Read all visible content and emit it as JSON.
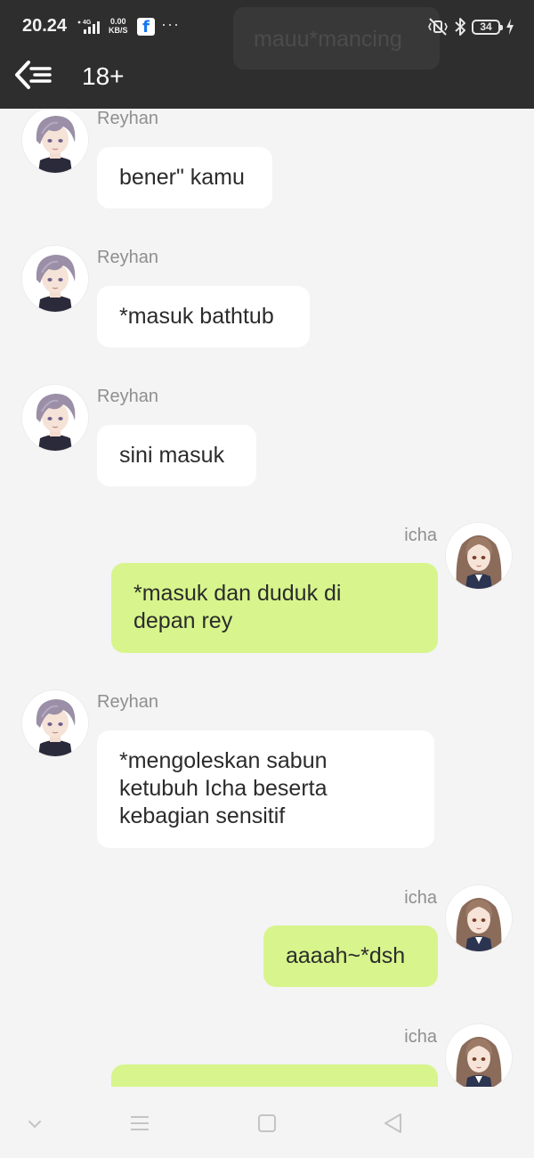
{
  "status_bar": {
    "time": "20.24",
    "network": "4G",
    "speed_value": "0.00",
    "speed_unit": "KB/S",
    "fb_letter": "f",
    "more_dots": "···",
    "battery_level": "34"
  },
  "notification_preview": "mauu*mancing",
  "header": {
    "title": "18+"
  },
  "colors": {
    "sent_bubble": "#d7f58c",
    "received_bubble": "#ffffff",
    "app_bar": "#2e2e2e",
    "background": "#f4f4f4"
  },
  "messages": [
    {
      "sender": "Reyhan",
      "side": "left",
      "lines": [
        "bener\" kamu"
      ]
    },
    {
      "sender": "Reyhan",
      "side": "left",
      "lines": [
        "*masuk bathtub"
      ]
    },
    {
      "sender": "Reyhan",
      "side": "left",
      "lines": [
        "sini masuk"
      ]
    },
    {
      "sender": "icha",
      "side": "right",
      "lines": [
        "*masuk dan duduk di",
        "depan rey"
      ]
    },
    {
      "sender": "Reyhan",
      "side": "left",
      "lines": [
        "*mengoleskan sabun",
        "ketubuh Icha beserta",
        "kebagian sensitif"
      ]
    },
    {
      "sender": "icha",
      "side": "right",
      "lines": [
        "aaaah~*dsh"
      ]
    },
    {
      "sender": "icha",
      "side": "right",
      "lines": [
        ""
      ]
    }
  ]
}
